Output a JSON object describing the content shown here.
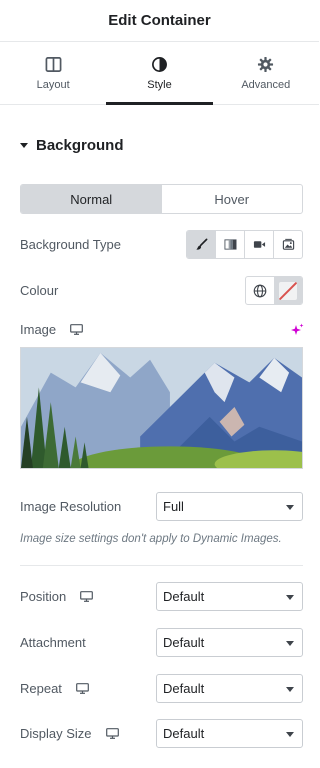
{
  "header": {
    "title": "Edit Container"
  },
  "tabs": [
    {
      "label": "Layout",
      "icon": "layout-columns-icon"
    },
    {
      "label": "Style",
      "icon": "half-circle-icon"
    },
    {
      "label": "Advanced",
      "icon": "gear-icon"
    }
  ],
  "active_tab": "Style",
  "section": {
    "title": "Background"
  },
  "state_toggle": {
    "normal": "Normal",
    "hover": "Hover",
    "selected": "Normal"
  },
  "background_type": {
    "label": "Background Type",
    "options": [
      "brush-icon",
      "gradient-icon",
      "video-icon",
      "slideshow-icon"
    ],
    "selected": "brush-icon"
  },
  "colour": {
    "label": "Colour"
  },
  "image": {
    "label": "Image"
  },
  "image_resolution": {
    "label": "Image Resolution",
    "value": "Full"
  },
  "note": "Image size settings don't apply to Dynamic Images.",
  "position": {
    "label": "Position",
    "value": "Default"
  },
  "attachment": {
    "label": "Attachment",
    "value": "Default"
  },
  "repeat": {
    "label": "Repeat",
    "value": "Default"
  },
  "display_size": {
    "label": "Display Size",
    "value": "Default"
  },
  "colors": {
    "accent": "#d004d4",
    "selected_bg": "#d5d8dc",
    "text": "#515962"
  }
}
